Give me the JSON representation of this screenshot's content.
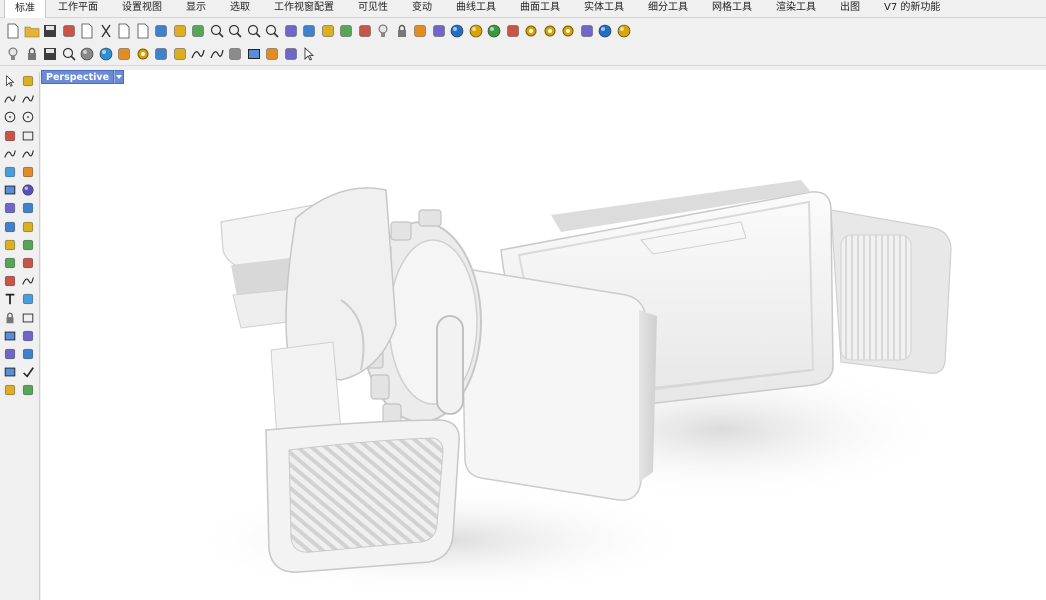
{
  "tabs": [
    "标准",
    "工作平面",
    "设置视图",
    "显示",
    "选取",
    "工作视窗配置",
    "可见性",
    "变动",
    "曲线工具",
    "曲面工具",
    "实体工具",
    "细分工具",
    "网格工具",
    "渲染工具",
    "出图",
    "V7 的新功能"
  ],
  "active_tab": 0,
  "toolbar1_icons": [
    "new-file-icon",
    "open-folder-icon",
    "save-icon",
    "print-icon",
    "import-icon",
    "cut-icon",
    "copy-icon",
    "paste-icon",
    "undo-icon",
    "pan-hand-icon",
    "rotate-view-icon",
    "zoom-icon",
    "zoom-window-icon",
    "zoom-extents-icon",
    "zoom-selected-icon",
    "undo-view-icon",
    "four-viewports-icon",
    "car-icon",
    "viewport-properties-icon",
    "named-views-icon",
    "light-bulb-icon",
    "lock-icon",
    "layer-shield-icon",
    "color-wheel-icon",
    "sphere-shaded-icon",
    "sphere-rendered-icon",
    "sphere-blue-icon",
    "highlight-icon",
    "gear-icon",
    "gear-options-icon",
    "gear-render-icon",
    "settings-panel-icon",
    "globe-icon",
    "help-icon"
  ],
  "toolbar2_icons": [
    "bulb-off-icon",
    "lock-small-icon",
    "save-small-icon",
    "zoom-frame-icon",
    "sphere-gray-icon",
    "sphere-blue-small-icon",
    "color-rings-icon",
    "gear-group-icon",
    "flame-icon",
    "mirror-icon",
    "curve-icon",
    "wave-icon",
    "blend-icon",
    "box-3d-icon",
    "surface-icon",
    "wrap-icon",
    "dashed-arrow-icon"
  ],
  "side_icons": [
    [
      "select-arrow-icon",
      "point-icon"
    ],
    [
      "polyline-icon",
      "curve-cp-icon"
    ],
    [
      "circle-icon",
      "ellipse-icon"
    ],
    [
      "polygon-icon",
      "rectangle-icon"
    ],
    [
      "arc-icon",
      "fillet-curve-icon"
    ],
    [
      "extrude-icon",
      "revolve-icon"
    ],
    [
      "box-icon",
      "sphere-icon"
    ],
    [
      "cylinder-icon",
      "surface-plane-icon"
    ],
    [
      "boolean-icon",
      "explode-icon"
    ],
    [
      "offset-icon",
      "trim-icon"
    ],
    [
      "paint-bucket-icon",
      "group-icon"
    ],
    [
      "fillet-icon",
      "blend-curve-icon"
    ],
    [
      "text-icon",
      "dimension-icon"
    ],
    [
      "block-icon",
      "layout-icon"
    ],
    [
      "solid-box-icon",
      "line-icon"
    ],
    [
      "array-icon",
      "move-icon"
    ],
    [
      "mirror-box-icon",
      "check-icon"
    ],
    [
      "analyze-icon",
      "render-icon"
    ]
  ],
  "viewport": {
    "title": "Perspective",
    "dropdown": "▾"
  },
  "colors": {
    "viewport_tab": "#6b8bd6",
    "model": "#f2f2f2",
    "background": "#ffffff"
  }
}
